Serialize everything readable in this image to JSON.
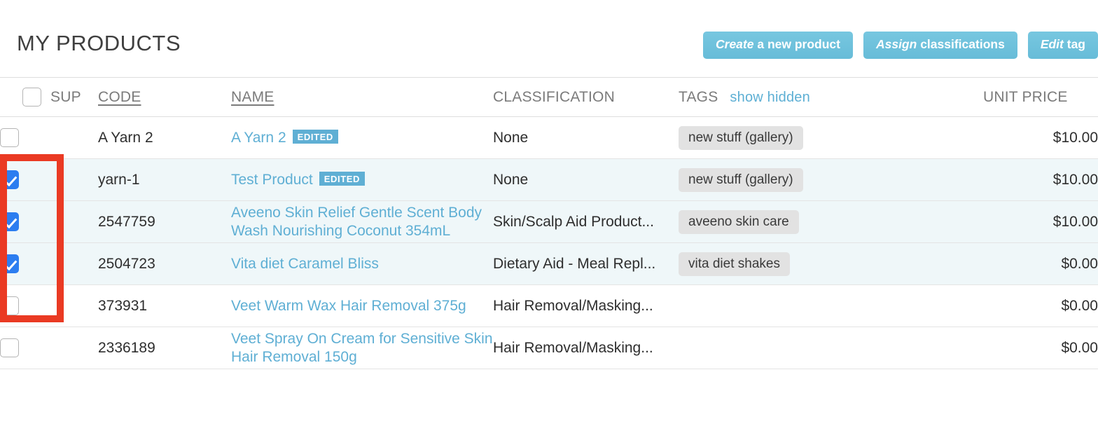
{
  "header": {
    "title": "MY PRODUCTS",
    "actions": [
      {
        "lead": "Create",
        "rest": " a new product",
        "name": "create-new-product-button"
      },
      {
        "lead": "Assign",
        "rest": " classifications",
        "name": "assign-classifications-button"
      },
      {
        "lead": "Edit",
        "rest": " tag",
        "name": "edit-tags-button"
      }
    ]
  },
  "table": {
    "columns": {
      "sup": "SUP",
      "code": "CODE",
      "name": "NAME",
      "classification": "CLASSIFICATION",
      "tags": "TAGS",
      "show_hidden": "show hidden",
      "unit_price": "UNIT PRICE"
    },
    "select_all_checked": false,
    "rows": [
      {
        "checked": false,
        "sup": "",
        "code": "A Yarn 2",
        "name": "A Yarn 2",
        "badge": "EDITED",
        "classification": "None",
        "tag": "new stuff (gallery)",
        "unit_price": "$10.00"
      },
      {
        "checked": true,
        "sup": "",
        "code": "yarn-1",
        "name": "Test Product",
        "badge": "EDITED",
        "classification": "None",
        "tag": "new stuff (gallery)",
        "unit_price": "$10.00"
      },
      {
        "checked": true,
        "sup": "",
        "code": "2547759",
        "name": "Aveeno Skin Relief Gentle Scent Body Wash Nourishing Coconut 354mL",
        "badge": "",
        "classification": "Skin/Scalp Aid Product...",
        "tag": "aveeno skin care",
        "unit_price": "$10.00"
      },
      {
        "checked": true,
        "sup": "",
        "code": "2504723",
        "name": "Vita diet Caramel Bliss",
        "badge": "",
        "classification": "Dietary Aid - Meal Repl...",
        "tag": "vita diet shakes",
        "unit_price": "$0.00"
      },
      {
        "checked": false,
        "sup": "",
        "code": "373931",
        "name": "Veet Warm Wax Hair Removal 375g",
        "badge": "",
        "classification": "Hair Removal/Masking...",
        "tag": "",
        "unit_price": "$0.00"
      },
      {
        "checked": false,
        "sup": "",
        "code": "2336189",
        "name": "Veet Spray On Cream for Sensitive Skin Hair Removal 150g",
        "badge": "",
        "classification": "Hair Removal/Masking...",
        "tag": "",
        "unit_price": "$0.00"
      }
    ]
  },
  "annotation": {
    "color": "#ea3a23",
    "label": "selected-rows-checkbox-highlight"
  },
  "colors": {
    "accent_button": "#6fc1dc",
    "link": "#5fafd4",
    "checkbox_checked": "#2c7df0",
    "selected_row_bg": "#eff7f9",
    "tag_bg": "#e2e2e2",
    "annotation": "#ea3a23"
  }
}
